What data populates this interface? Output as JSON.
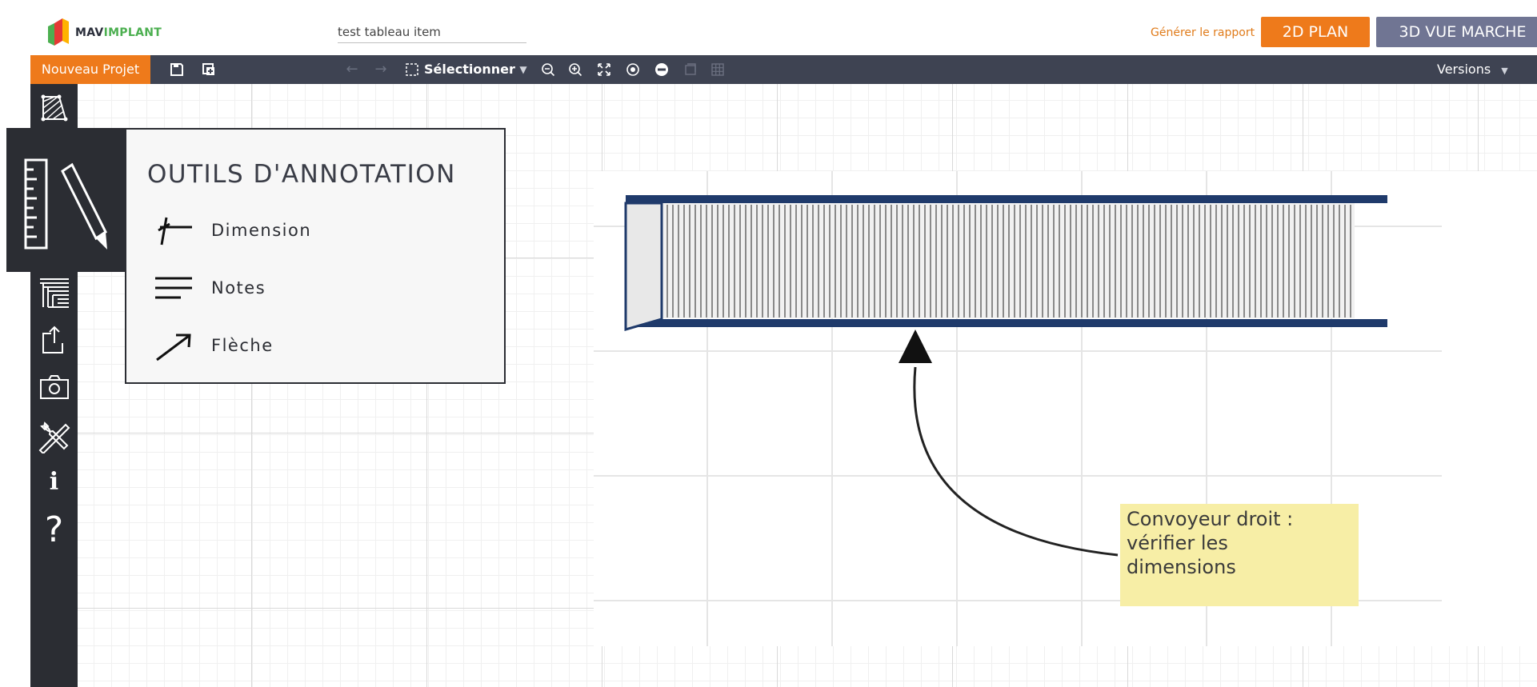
{
  "header": {
    "brand_mav": "MAV",
    "brand_implant": "IMPLANT",
    "project_name": "test tableau item",
    "report_link": "Générer le rapport",
    "mode_2d": "2D PLAN",
    "mode_3d_vue": "3D VUE MARCHE",
    "mode_3d_cut": "3"
  },
  "toolbar": {
    "new_project": "Nouveau Projet",
    "select": "Sélectionner",
    "versions": "Versions"
  },
  "sidebar": {
    "info_glyph": "i",
    "help_glyph": "?"
  },
  "annotation_popup": {
    "title": "OUTILS D'ANNOTATION",
    "items": [
      {
        "label": "Dimension",
        "icon": "dimension-icon"
      },
      {
        "label": "Notes",
        "icon": "notes-icon"
      },
      {
        "label": "Flèche",
        "icon": "arrow-icon"
      }
    ]
  },
  "canvas_note": {
    "text_line1": "Convoyeur droit :",
    "text_line2": "vérifier les",
    "text_line3": "dimensions"
  },
  "colors": {
    "accent_orange": "#ee7a1b",
    "secondary_purple": "#707593",
    "toolbar_bg": "#3e4352",
    "sidebar_bg": "#2b2d33",
    "note_yellow": "#f7eea6",
    "conveyor_blue": "#1f3a6b"
  }
}
